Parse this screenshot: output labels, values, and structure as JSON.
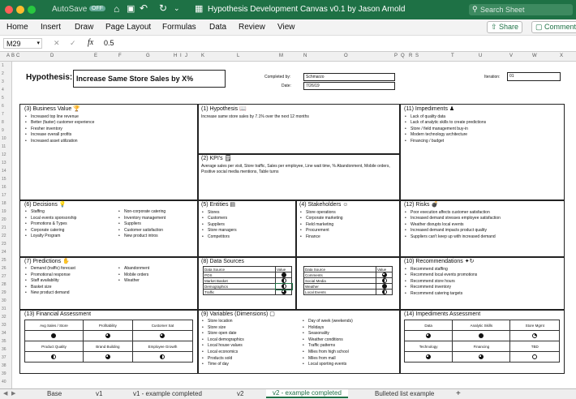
{
  "window": {
    "autosave": "AutoSave",
    "autosave_state": "OFF",
    "title": "Hypothesis Development Canvas v0.1 by Jason Arnold",
    "search_placeholder": "Search Sheet"
  },
  "ribbon": {
    "tabs": [
      "Home",
      "Insert",
      "Draw",
      "Page Layout",
      "Formulas",
      "Data",
      "Review",
      "View"
    ],
    "share": "Share",
    "comments": "Comments"
  },
  "formula": {
    "cell": "M29",
    "fx": "fx",
    "value": "0.5"
  },
  "columns": [
    "A",
    "B",
    "C",
    "D",
    "E",
    "F",
    "G",
    "H",
    "I",
    "J",
    "K",
    "L",
    "M",
    "N",
    "O",
    "P",
    "Q",
    "R",
    "S",
    "T",
    "U",
    "V",
    "W",
    "X"
  ],
  "rows": [
    "1",
    "2",
    "3",
    "4",
    "5",
    "6",
    "7",
    "8",
    "9",
    "10",
    "11",
    "12",
    "13",
    "14",
    "15",
    "16",
    "17",
    "18",
    "19",
    "20",
    "21",
    "22",
    "23",
    "24",
    "25",
    "26",
    "27",
    "28",
    "29",
    "30",
    "31",
    "32",
    "33",
    "34",
    "35",
    "36",
    "37",
    "38",
    "39",
    "40"
  ],
  "header": {
    "hyp_label": "Hypothesis:",
    "hyp_value": "Increase Same Store Sales by X%",
    "completed_label": "Completed by:",
    "completed_value": "Schmarzo",
    "date_label": "Date:",
    "date_value": "7/26/19",
    "iteration_label": "Iteration:",
    "iteration_value": "01"
  },
  "business_value": {
    "title": "(3) Business Value 🏆",
    "items": [
      "Increased top line revenue",
      "Better (faster) customer experience",
      "Fresher inventory",
      "Increase overall profits",
      "Increased asset utilization"
    ]
  },
  "hypothesis": {
    "title": "(1) Hypothesis 📖",
    "text": "Increase same store sales by 7.1% over the next 12 months"
  },
  "kpis": {
    "title": "(2) KPI's 🗒",
    "text": "Average sales per visit, Store traffic, Sales per employee, Line wait time, % Abandonment, Mobile orders, Positive social media mentions, Table turns"
  },
  "impediments": {
    "title": "(11) Impediments ♟",
    "items": [
      "Lack of quality data",
      "Lack of analytic skills to create predictions",
      "Store / field management buy-in",
      "Modern technology architecture",
      "Financing / budget"
    ]
  },
  "decisions": {
    "title": "(6) Decisions 💡",
    "col1": [
      "Staffing",
      "Local events sponsorship",
      "Promotions & Types",
      "Corporate catering",
      "Loyalty Program"
    ],
    "col2": [
      "Non-corporate catering",
      "Inventory management",
      "Suppliers",
      "Customer satisfaction",
      "New product intros"
    ]
  },
  "entities": {
    "title": "(5) Entities ▤",
    "items": [
      "Stores",
      "Customers",
      "Suppliers",
      "Store managers",
      "Competitors"
    ]
  },
  "stakeholders": {
    "title": "(4) Stakeholders ☺",
    "items": [
      "Store operations",
      "Corporate marketing",
      "Field marketing",
      "Procurement",
      "Finance"
    ]
  },
  "risks": {
    "title": "(12) Risks 💣",
    "items": [
      "Poor execution affects customer satisfaction",
      "Increased demand stresses employee satisfaction",
      "Weather disrupts local events",
      "Increased demand impacts product quality",
      "Suppliers can't keep up with increased demand"
    ]
  },
  "predictions": {
    "title": "(7) Predictions ✋",
    "col1": [
      "Demand (traffic) forecast",
      "Promotional response",
      "Staff availability",
      "Basket size",
      "New product demand"
    ],
    "col2": [
      "Abandonment",
      "Mobile orders",
      "Weather"
    ]
  },
  "data_sources": {
    "title": "(8) Data Sources",
    "header": [
      "Data Source",
      "Value"
    ],
    "left": [
      "POS",
      "Market Basket",
      "Demographics",
      "Traffic"
    ],
    "right": [
      "Comments",
      "Social Media",
      "Weather",
      "Local Events"
    ]
  },
  "recommendations": {
    "title": "(10) Recommendations ✦↻",
    "items": [
      "Recommend staffing",
      "Recommend local events promotions",
      "Recommend store hours",
      "Recommend inventory",
      "Recommend catering targets"
    ]
  },
  "financial": {
    "title": "(13) Financial Assessment",
    "row1": [
      "Avg Sales / Store",
      "Profitability",
      "Customer Sat"
    ],
    "row2": [
      "Product Quality",
      "Brand Building",
      "Employee Growth"
    ]
  },
  "variables": {
    "title": "(9) Variables (Dimensions) ▢",
    "col1": [
      "Store location",
      "Store size",
      "Store open date",
      "Local demographics",
      "Local house values",
      "Local economics",
      "Products sold",
      "Time of day"
    ],
    "col2": [
      "Day of week (weekends)",
      "Holidays",
      "Seasonality",
      "Weather conditions",
      "Traffic patterns",
      "Miles from high school",
      "Miles from mall",
      "Local sporting events"
    ]
  },
  "imp_assessment": {
    "title": "(14) Impediments Assessment",
    "row1": [
      "Data",
      "Analytic Skills",
      "Store Mgmt"
    ],
    "row2": [
      "Technology",
      "Financing",
      "TBD"
    ]
  },
  "sheets": [
    "Base",
    "v1",
    "v1 - example completed",
    "v2",
    "v2 - example completed",
    "Bulleted list example",
    "+"
  ]
}
